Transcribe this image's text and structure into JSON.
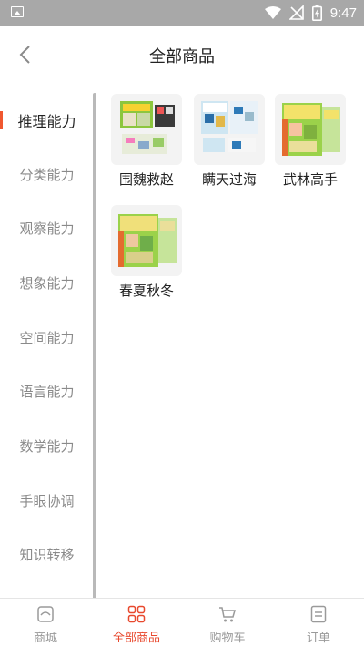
{
  "status_bar": {
    "time": "9:47"
  },
  "header": {
    "title": "全部商品"
  },
  "categories": [
    {
      "label": "推理能力",
      "active": true
    },
    {
      "label": "分类能力",
      "active": false
    },
    {
      "label": "观察能力",
      "active": false
    },
    {
      "label": "想象能力",
      "active": false
    },
    {
      "label": "空间能力",
      "active": false
    },
    {
      "label": "语言能力",
      "active": false
    },
    {
      "label": "数学能力",
      "active": false
    },
    {
      "label": "手眼协调",
      "active": false
    },
    {
      "label": "知识转移",
      "active": false
    }
  ],
  "products": [
    {
      "name": "围魏救赵"
    },
    {
      "name": "瞒天过海"
    },
    {
      "name": "武林高手"
    },
    {
      "name": "春夏秋冬"
    }
  ],
  "tabbar": [
    {
      "label": "商城",
      "icon": "shop-icon",
      "active": false
    },
    {
      "label": "全部商品",
      "icon": "grid-icon",
      "active": true
    },
    {
      "label": "购物车",
      "icon": "cart-icon",
      "active": false
    },
    {
      "label": "订单",
      "icon": "order-icon",
      "active": false
    }
  ],
  "colors": {
    "accent": "#e8482d",
    "status_bar": "#a8a8a8",
    "inactive_text": "#8a8a8a"
  }
}
